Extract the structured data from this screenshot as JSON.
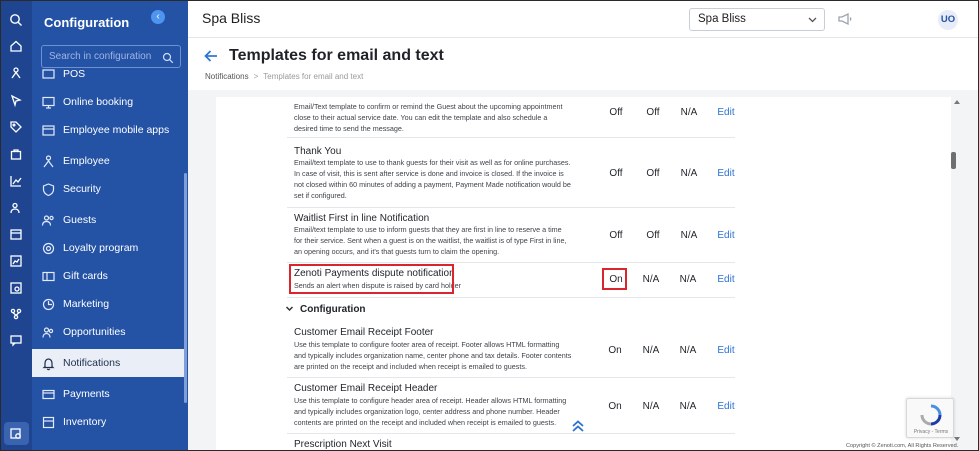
{
  "sidebar": {
    "title": "Configuration",
    "collapse_icon": "chevron-left-icon",
    "search_placeholder": "Search in configuration",
    "items": [
      {
        "label": "POS",
        "icon": "pos-icon"
      },
      {
        "label": "Online booking",
        "icon": "monitor-icon"
      },
      {
        "label": "Employee mobile apps",
        "icon": "mobile-icon"
      },
      {
        "label": "Employee",
        "icon": "employee-icon"
      },
      {
        "label": "Security",
        "icon": "shield-icon"
      },
      {
        "label": "Guests",
        "icon": "guests-icon"
      },
      {
        "label": "Loyalty program",
        "icon": "loyalty-icon"
      },
      {
        "label": "Gift cards",
        "icon": "gift-card-icon"
      },
      {
        "label": "Marketing",
        "icon": "marketing-icon"
      },
      {
        "label": "Opportunities",
        "icon": "opportunities-icon"
      },
      {
        "label": "Notifications",
        "icon": "bell-icon",
        "active": true
      },
      {
        "label": "Payments",
        "icon": "payments-icon"
      },
      {
        "label": "Inventory",
        "icon": "inventory-icon"
      }
    ]
  },
  "header": {
    "brand": "Spa Bliss",
    "center_select": "Spa Bliss",
    "avatar_initials": "UO"
  },
  "page": {
    "title": "Templates for email and text",
    "breadcrumb": [
      "Notifications",
      "Templates for email and text"
    ]
  },
  "templates": [
    {
      "name": "",
      "description": "Email/Text template to confirm or remind the Guest about the upcoming appointment close to their actual service date. You can edit the template and also schedule a desired time to send the message.",
      "cols": [
        "Off",
        "Off",
        "N/A"
      ],
      "action": "Edit"
    },
    {
      "name": "Thank You",
      "description": "Email/text template to use to thank guests for their visit as well as for online purchases. In case of visit, this is sent after service is done and invoice is closed. If the invoice is not closed within 60 minutes of adding a payment, Payment Made notification would be set if configured.",
      "cols": [
        "Off",
        "Off",
        "N/A"
      ],
      "action": "Edit"
    },
    {
      "name": "Waitlist First in line Notification",
      "description": "Email/text template to use to inform guests that they are first in line to reserve a time for their service. Sent when a guest is on the waitlist, the waitlist is of type First in line, an opening occurs, and it's that guests turn to claim the opening.",
      "cols": [
        "Off",
        "Off",
        "N/A"
      ],
      "action": "Edit"
    },
    {
      "name": "Zenoti Payments dispute notification",
      "description": "Sends an alert when dispute is raised by card holder",
      "cols": [
        "On",
        "N/A",
        "N/A"
      ],
      "action": "Edit"
    }
  ],
  "section": {
    "title": "Configuration"
  },
  "config_templates": [
    {
      "name": "Customer Email Receipt Footer",
      "description": "Use this template to configure footer area of receipt. Footer allows HTML formatting and typically includes organization name, center phone and tax details. Footer contents are printed on the receipt and included when receipt is emailed to guests.",
      "cols": [
        "On",
        "N/A",
        "N/A"
      ],
      "action": "Edit"
    },
    {
      "name": "Customer Email Receipt Header",
      "description": "Use this template to configure header area of receipt. Header allows HTML formatting and typically includes organization logo, center address and phone number. Header contents are printed on the receipt and included when receipt is emailed to guests.",
      "cols": [
        "On",
        "N/A",
        "N/A"
      ],
      "action": "Edit"
    },
    {
      "name": "Prescription Next Visit",
      "description": "",
      "cols": [],
      "action": ""
    }
  ],
  "footer": {
    "copyright": "Copyright © Zenoti.com, All Rights Reserved.",
    "recaptcha_text": "Privacy - Terms"
  },
  "colors": {
    "rail": "#1f4590",
    "sidebar": "#2453a6",
    "accent": "#2b73d3",
    "highlight": "#d9262d"
  }
}
